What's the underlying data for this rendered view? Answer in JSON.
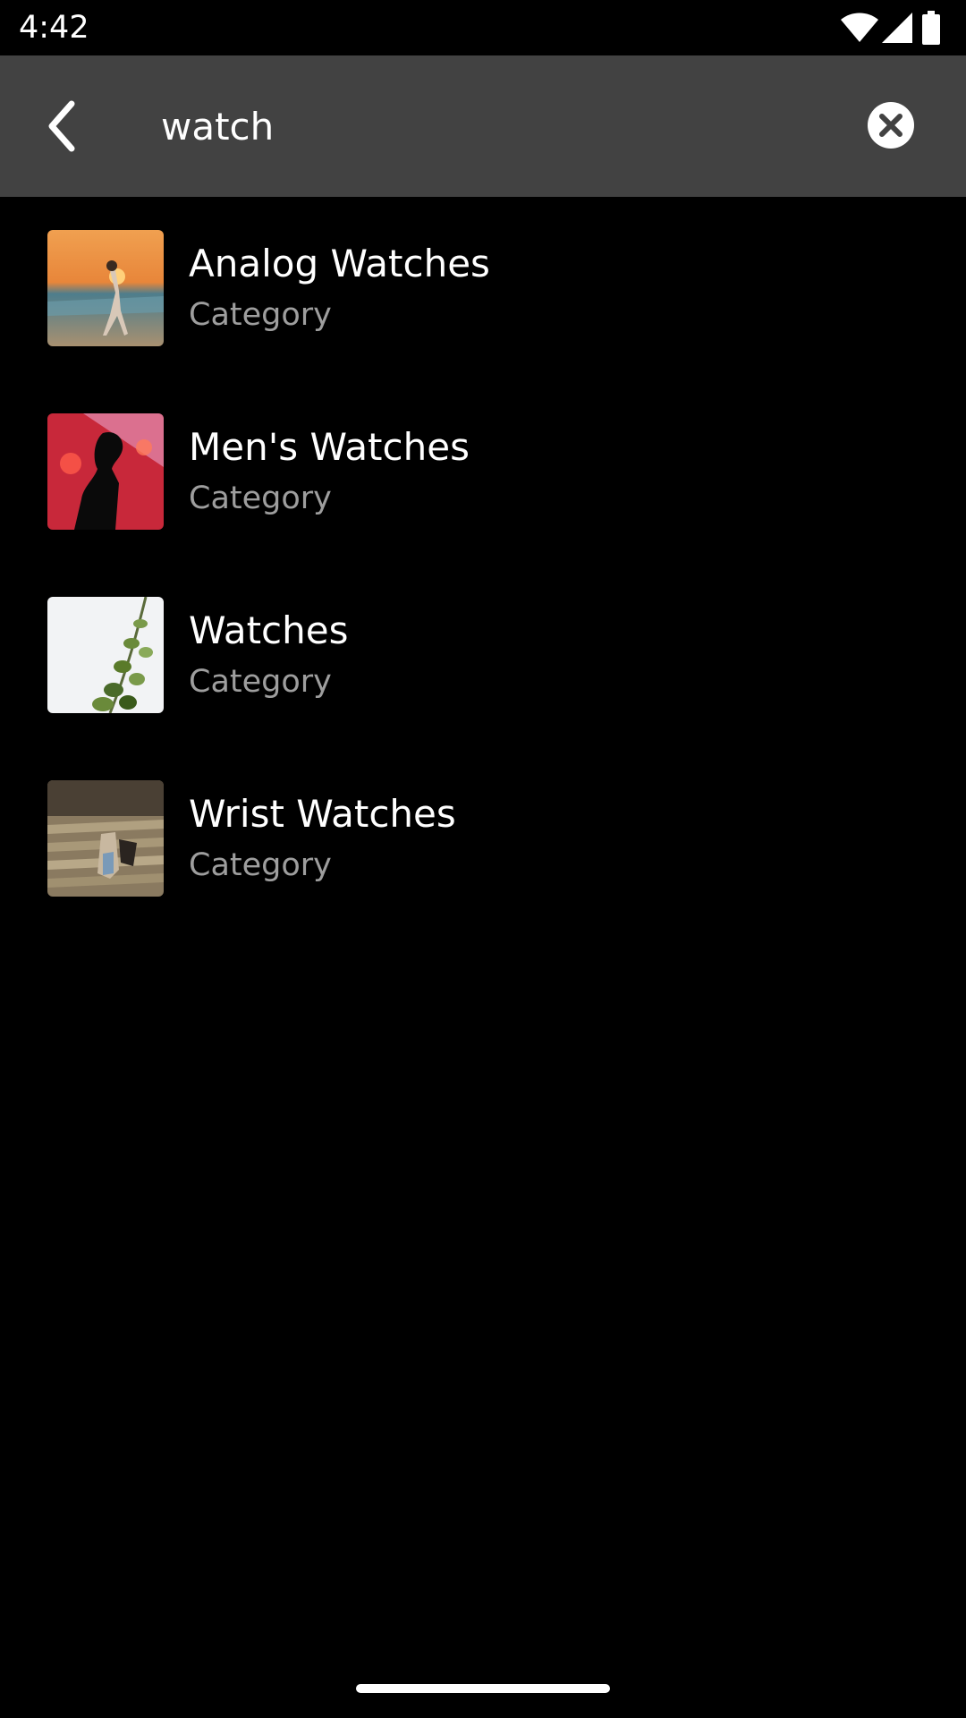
{
  "status_bar": {
    "time": "4:42",
    "icons": [
      "wifi-icon",
      "cellular-signal-icon",
      "battery-icon"
    ]
  },
  "search": {
    "value": "watch",
    "back_icon": "back-arrow-icon",
    "clear_icon": "clear-icon"
  },
  "results": [
    {
      "title": "Analog Watches",
      "subtitle": "Category",
      "thumbnail": "beach-sunset-thumbnail"
    },
    {
      "title": "Men's Watches",
      "subtitle": "Category",
      "thumbnail": "concert-silhouette-thumbnail"
    },
    {
      "title": "Watches",
      "subtitle": "Category",
      "thumbnail": "plant-thumbnail"
    },
    {
      "title": "Wrist Watches",
      "subtitle": "Category",
      "thumbnail": "stairs-thumbnail"
    }
  ],
  "colors": {
    "background": "#000000",
    "search_bar": "#424242",
    "primary_text": "#ffffff",
    "secondary_text": "#9e9e9e"
  }
}
